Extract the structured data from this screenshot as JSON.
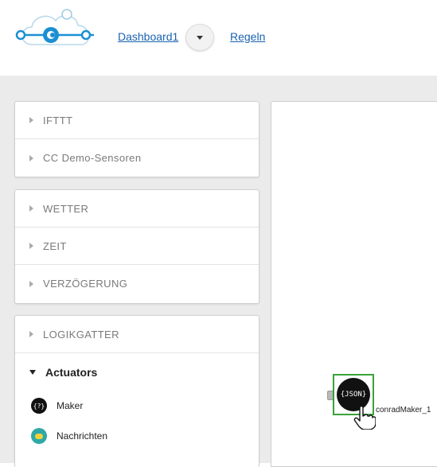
{
  "header": {
    "dashboard_label": "Dashboard1",
    "rules_label": "Regeln"
  },
  "sidebar": {
    "group1": [
      {
        "label": "IFTTT"
      },
      {
        "label": "CC Demo-Sensoren"
      }
    ],
    "group2": [
      {
        "label": "WETTER"
      },
      {
        "label": "ZEIT"
      },
      {
        "label": "VERZÖGERUNG"
      }
    ],
    "group3": {
      "collapsed": "LOGIKGATTER",
      "expanded": "Actuators",
      "items": [
        {
          "label": "Maker",
          "icon": "json-maker-icon"
        },
        {
          "label": "Nachrichten",
          "icon": "message-bubble-icon"
        }
      ]
    }
  },
  "canvas": {
    "node_label": "conradMaker_1",
    "node_icon_text": "{JSON}"
  },
  "colors": {
    "link": "#1a62b0",
    "node_border": "#3aa23a",
    "band": "#ebebeb"
  }
}
